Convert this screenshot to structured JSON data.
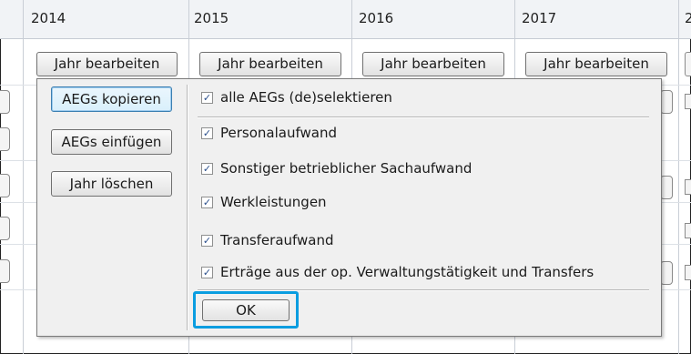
{
  "years": [
    {
      "label": "2014",
      "button": "Jahr bearbeiten"
    },
    {
      "label": "2015",
      "button": "Jahr bearbeiten"
    },
    {
      "label": "2016",
      "button": "Jahr bearbeiten"
    },
    {
      "label": "2017",
      "button": "Jahr bearbeiten"
    },
    {
      "label": "2"
    }
  ],
  "popup": {
    "side_buttons": [
      "AEGs kopieren",
      "AEGs einfügen",
      "Jahr löschen"
    ],
    "select_all": {
      "label": "alle AEGs (de)selektieren",
      "checked": true
    },
    "items": [
      {
        "label": "Personalaufwand",
        "checked": true
      },
      {
        "label": "Sonstiger betrieblicher Sachaufwand",
        "checked": true
      },
      {
        "label": "Werkleistungen",
        "checked": true
      },
      {
        "label": "Transferaufwand",
        "checked": true
      },
      {
        "label": "Erträge aus der op. Verwaltungstätigkeit und Transfers",
        "checked": true
      }
    ],
    "ok_label": "OK"
  },
  "colors": {
    "highlight": "#0a9de0",
    "header_bg": "#f1f3f6",
    "popup_bg": "#f0f0f0",
    "checkmark": "#2b4f8c"
  },
  "icons": {
    "checkbox": "checkmark-icon"
  }
}
